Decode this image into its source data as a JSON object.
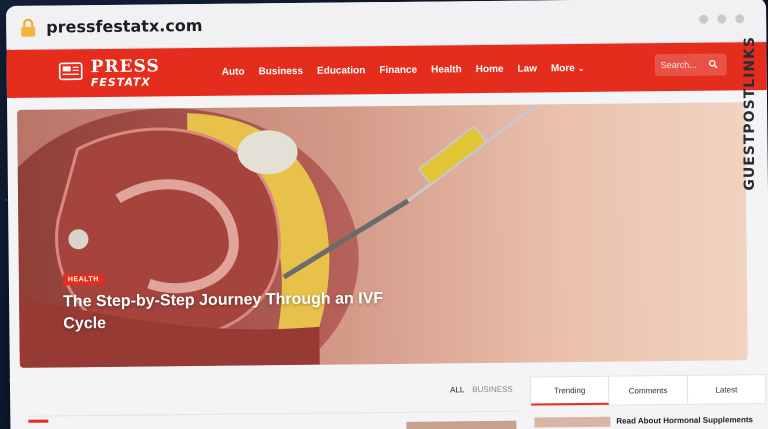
{
  "browser": {
    "url": "pressfestatx.com"
  },
  "site": {
    "logo_main": "PRESS",
    "logo_sub": "FESTATX",
    "nav": [
      {
        "label": "Auto"
      },
      {
        "label": "Business"
      },
      {
        "label": "Education"
      },
      {
        "label": "Finance"
      },
      {
        "label": "Health"
      },
      {
        "label": "Home"
      },
      {
        "label": "Law"
      },
      {
        "label": "More"
      }
    ],
    "search_placeholder": "Search..."
  },
  "hero": {
    "category": "HEALTH",
    "title": "The Step-by-Step Journey Through an IVF Cycle"
  },
  "content": {
    "filter_all": "ALL",
    "filter_business": "BUSINESS",
    "sidebar_tabs": [
      "Trending",
      "Comments",
      "Latest"
    ],
    "sidebar_headline": "Read About Hormonal Supplements"
  },
  "watermark": "GUESTPOSTLINKS",
  "colors": {
    "brand_red": "#e52d1e",
    "background_navy": "#0e1a2e"
  }
}
